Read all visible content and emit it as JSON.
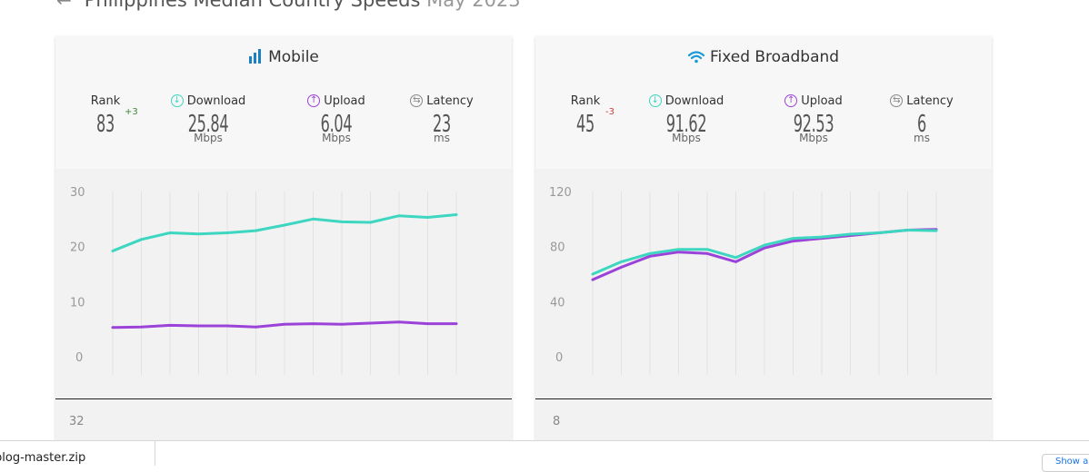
{
  "page": {
    "title": "Philippines Median Country Speeds",
    "month": "May 2023"
  },
  "mobile": {
    "title": "Mobile",
    "rank_label": "Rank",
    "rank": "83",
    "rank_change": "+3",
    "download_label": "Download",
    "download": "25.84",
    "download_unit": "Mbps",
    "upload_label": "Upload",
    "upload": "6.04",
    "upload_unit": "Mbps",
    "latency_label": "Latency",
    "latency": "23",
    "latency_unit": "ms",
    "next_chart_top_tick": "32"
  },
  "fixed": {
    "title": "Fixed Broadband",
    "rank_label": "Rank",
    "rank": "45",
    "rank_change": "-3",
    "download_label": "Download",
    "download": "91.62",
    "download_unit": "Mbps",
    "upload_label": "Upload",
    "upload": "92.53",
    "upload_unit": "Mbps",
    "latency_label": "Latency",
    "latency": "6",
    "latency_unit": "ms",
    "next_chart_top_tick": "8"
  },
  "colors": {
    "download": "#3dd6c0",
    "upload": "#9b43d8",
    "mobile_icon": "#1a7fc4",
    "wifi_icon": "#1a9ad6"
  },
  "icons": {
    "back": "arrow-left-icon",
    "mobile": "signal-bars-icon",
    "fixed": "wifi-icon",
    "download": "download-arrow-icon",
    "upload": "upload-arrow-icon",
    "latency": "latency-icon"
  },
  "chart_data": [
    {
      "type": "line",
      "ylim": [
        0,
        30
      ],
      "yticks": [
        "0",
        "10",
        "20",
        "30"
      ],
      "x": [
        1,
        2,
        3,
        4,
        5,
        6,
        7,
        8,
        9,
        10,
        11,
        12,
        13
      ],
      "series": [
        {
          "values": [
            19.2,
            21.3,
            22.5,
            22.3,
            22.5,
            22.9,
            23.9,
            25.0,
            24.5,
            24.4,
            25.6,
            25.3,
            25.8
          ]
        },
        {
          "values": [
            5.3,
            5.4,
            5.7,
            5.6,
            5.6,
            5.4,
            5.9,
            6.0,
            5.9,
            6.1,
            6.3,
            6.0,
            6.0
          ]
        }
      ]
    },
    {
      "type": "line",
      "ylim": [
        0,
        120
      ],
      "yticks": [
        "0",
        "40",
        "80",
        "120"
      ],
      "x": [
        1,
        2,
        3,
        4,
        5,
        6,
        7,
        8,
        9,
        10,
        11,
        12,
        13
      ],
      "series": [
        {
          "values": [
            60,
            69,
            75,
            78,
            78,
            72,
            81,
            86,
            87,
            89,
            90,
            92,
            91.6
          ]
        },
        {
          "values": [
            56,
            65,
            73,
            76,
            75,
            69,
            79,
            84,
            86,
            88,
            90,
            92,
            92.5
          ]
        }
      ]
    }
  ],
  "downloads": {
    "file_name": "blog-master.zip",
    "show_all": "Show all"
  }
}
